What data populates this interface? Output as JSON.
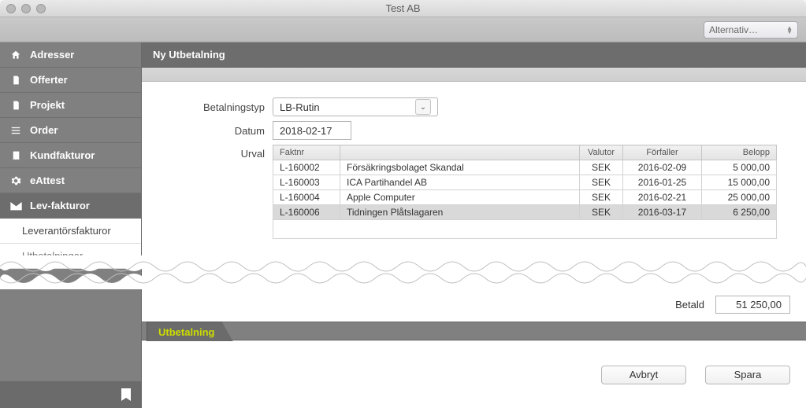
{
  "window": {
    "title": "Test AB"
  },
  "toolbar": {
    "alternativ": "Alternativ…"
  },
  "sidebar": {
    "items": [
      {
        "label": "Adresser"
      },
      {
        "label": "Offerter"
      },
      {
        "label": "Projekt"
      },
      {
        "label": "Order"
      },
      {
        "label": "Kundfakturor"
      },
      {
        "label": "eAttest"
      },
      {
        "label": "Lev-fakturor"
      }
    ],
    "sub": [
      {
        "label": "Leverantörsfakturor"
      },
      {
        "label": "Utbetalningar"
      }
    ]
  },
  "header": {
    "title": "Ny Utbetalning"
  },
  "form": {
    "betalningstyp_label": "Betalningstyp",
    "betalningstyp_value": "LB-Rutin",
    "datum_label": "Datum",
    "datum_value": "2018-02-17",
    "urval_label": "Urval"
  },
  "table": {
    "headers": [
      "Faktnr",
      "",
      "Valutor",
      "Förfaller",
      "Belopp"
    ],
    "rows": [
      {
        "faktnr": "L-160002",
        "name": "Försäkringsbolaget Skandal",
        "valuta": "SEK",
        "forfaller": "2016-02-09",
        "belopp": "5 000,00",
        "selected": false
      },
      {
        "faktnr": "L-160003",
        "name": "ICA Partihandel AB",
        "valuta": "SEK",
        "forfaller": "2016-01-25",
        "belopp": "15 000,00",
        "selected": false
      },
      {
        "faktnr": "L-160004",
        "name": "Apple Computer",
        "valuta": "SEK",
        "forfaller": "2016-02-21",
        "belopp": "25 000,00",
        "selected": false
      },
      {
        "faktnr": "L-160006",
        "name": "Tidningen Plåtslagaren",
        "valuta": "SEK",
        "forfaller": "2016-03-17",
        "belopp": "6 250,00",
        "selected": true
      }
    ]
  },
  "summary": {
    "betald_label": "Betald",
    "betald_value": "51 250,00"
  },
  "tabs": {
    "utbetalning": "Utbetalning"
  },
  "footer": {
    "cancel": "Avbryt",
    "save": "Spara"
  }
}
